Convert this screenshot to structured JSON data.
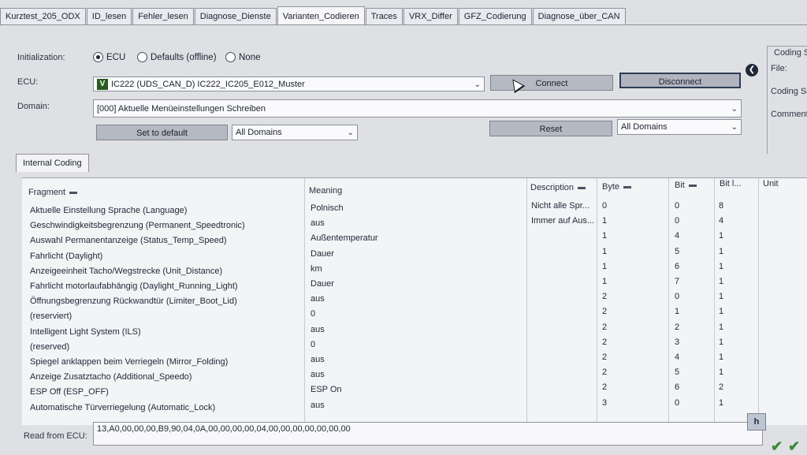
{
  "tabs": [
    "Kurztest_205_ODX",
    "ID_lesen",
    "Fehler_lesen",
    "Diagnose_Dienste",
    "Varianten_Codieren",
    "Traces",
    "VRX_Differ",
    "GFZ_Codierung",
    "Diagnose_über_CAN"
  ],
  "active_tab": "Varianten_Codieren",
  "init": {
    "label": "Initialization:",
    "options": [
      "ECU",
      "Defaults (offline)",
      "None"
    ],
    "selected": "ECU"
  },
  "ecu": {
    "label": "ECU:",
    "badge": "V",
    "value": "IC222 (UDS_CAN_D) IC222_IC205_E012_Muster"
  },
  "buttons": {
    "connect": "Connect",
    "disconnect": "Disconnect",
    "set_default": "Set to default",
    "reset": "Reset",
    "h": "h"
  },
  "domain": {
    "label": "Domain:",
    "value": "[000] Aktuelle Menüeinstellungen Schreiben",
    "filter_left": "All Domains",
    "filter_right": "All Domains"
  },
  "right_panel": {
    "title": "Coding S",
    "file": "File:",
    "coding_se": "Coding Se",
    "comment": "Comment:"
  },
  "subtab": "Internal Coding",
  "table": {
    "headers": [
      "Fragment",
      "Meaning",
      "Description",
      "Byte",
      "Bit",
      "Bit l...",
      "Unit"
    ],
    "rows": [
      {
        "fragment": "Aktuelle Einstellung Sprache (Language)",
        "meaning": "Polnisch",
        "description": "Nicht alle Spr...",
        "byte": "0",
        "bit": "0",
        "bitlen": "8"
      },
      {
        "fragment": "Geschwindigkeitsbegrenzung (Permanent_Speedtronic)",
        "meaning": "aus",
        "description": "Immer auf Aus...",
        "byte": "1",
        "bit": "0",
        "bitlen": "4"
      },
      {
        "fragment": "Auswahl Permanentanzeige (Status_Temp_Speed)",
        "meaning": "Außentemperatur",
        "description": "",
        "byte": "1",
        "bit": "4",
        "bitlen": "1"
      },
      {
        "fragment": "Fahrlicht (Daylight)",
        "meaning": "Dauer",
        "description": "",
        "byte": "1",
        "bit": "5",
        "bitlen": "1"
      },
      {
        "fragment": "Anzeigeeinheit Tacho/Wegstrecke (Unit_Distance)",
        "meaning": "km",
        "description": "",
        "byte": "1",
        "bit": "6",
        "bitlen": "1"
      },
      {
        "fragment": "Fahrlicht motorlaufabhängig (Daylight_Running_Light)",
        "meaning": "Dauer",
        "description": "",
        "byte": "1",
        "bit": "7",
        "bitlen": "1"
      },
      {
        "fragment": "Öffnungsbegrenzung Rückwandtür (Limiter_Boot_Lid)",
        "meaning": "aus",
        "description": "",
        "byte": "2",
        "bit": "0",
        "bitlen": "1"
      },
      {
        "fragment": "(reserviert)",
        "meaning": "0",
        "description": "",
        "byte": "2",
        "bit": "1",
        "bitlen": "1"
      },
      {
        "fragment": "Intelligent Light System (ILS)",
        "meaning": "aus",
        "description": "",
        "byte": "2",
        "bit": "2",
        "bitlen": "1"
      },
      {
        "fragment": "(reserved)",
        "meaning": "0",
        "description": "",
        "byte": "2",
        "bit": "3",
        "bitlen": "1"
      },
      {
        "fragment": "Spiegel anklappen beim Verriegeln (Mirror_Folding)",
        "meaning": "aus",
        "description": "",
        "byte": "2",
        "bit": "4",
        "bitlen": "1"
      },
      {
        "fragment": "Anzeige Zusatztacho (Additional_Speedo)",
        "meaning": "aus",
        "description": "",
        "byte": "2",
        "bit": "5",
        "bitlen": "1"
      },
      {
        "fragment": "ESP Off (ESP_OFF)",
        "meaning": "ESP On",
        "description": "",
        "byte": "2",
        "bit": "6",
        "bitlen": "2"
      },
      {
        "fragment": "Automatische Türverriegelung (Automatic_Lock)",
        "meaning": "aus",
        "description": "",
        "byte": "3",
        "bit": "0",
        "bitlen": "1"
      }
    ]
  },
  "read_from_ecu": {
    "label": "Read from ECU:",
    "value": "13,A0,00,00,00,B9,90,04,0A,00,00,00,00,04,00,00,00,00,00,00,00"
  }
}
